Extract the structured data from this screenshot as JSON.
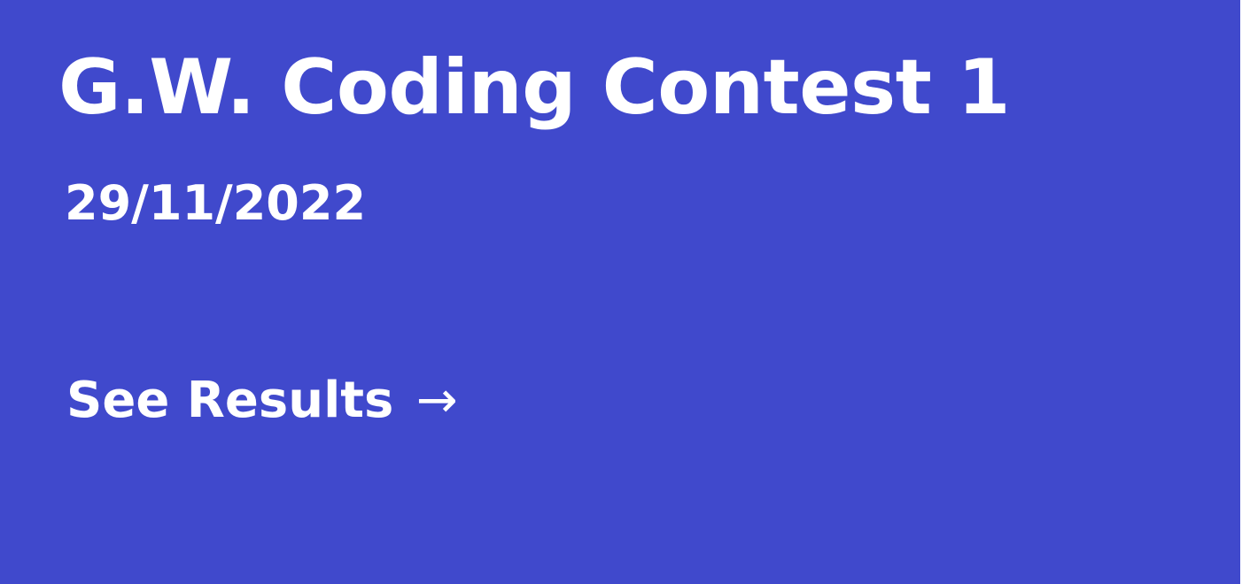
{
  "card": {
    "title": "G.W. Coding Contest 1",
    "date": "29/11/2022",
    "link_label": "See Results",
    "link_arrow": "→",
    "background_color": "#4049cc",
    "text_color": "#ffffff"
  }
}
